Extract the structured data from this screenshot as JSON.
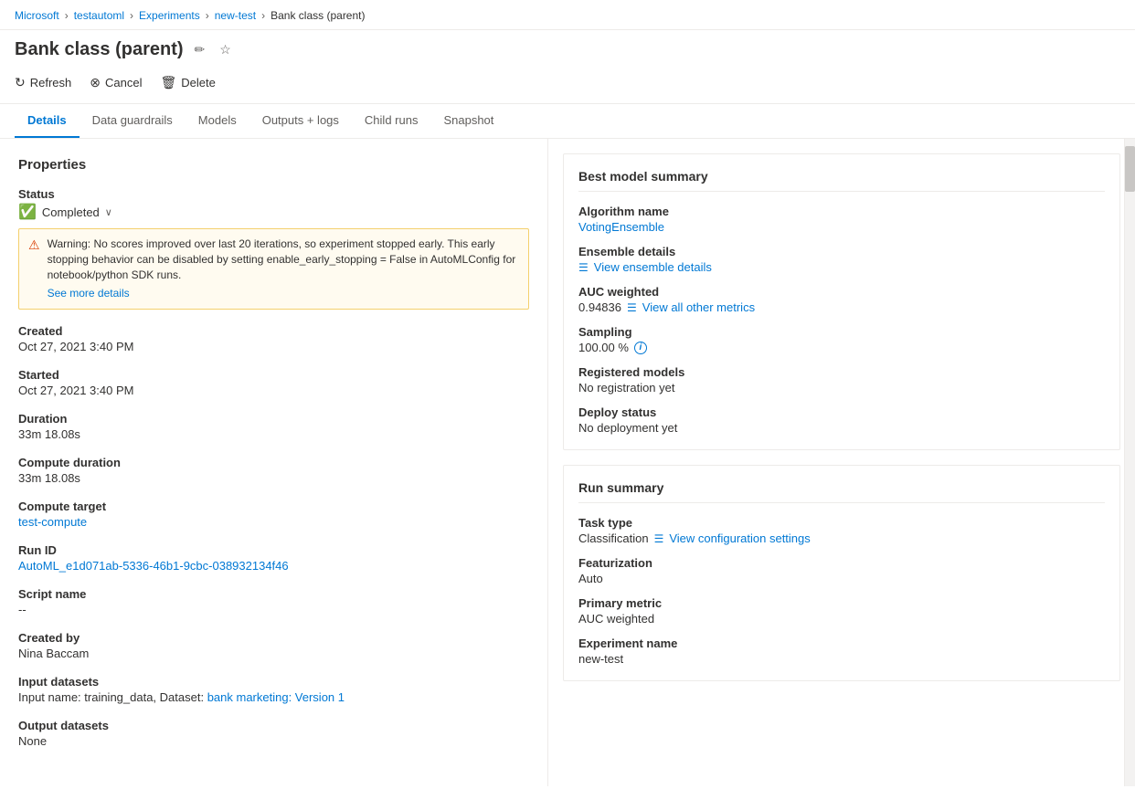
{
  "breadcrumb": {
    "items": [
      {
        "label": "Microsoft",
        "href": "#"
      },
      {
        "label": "testautoml",
        "href": "#"
      },
      {
        "label": "Experiments",
        "href": "#"
      },
      {
        "label": "new-test",
        "href": "#"
      },
      {
        "label": "Bank class (parent)",
        "current": true
      }
    ]
  },
  "header": {
    "title": "Bank class (parent)",
    "edit_label": "✏",
    "star_label": "☆"
  },
  "toolbar": {
    "refresh_label": "Refresh",
    "cancel_label": "Cancel",
    "delete_label": "Delete"
  },
  "tabs": [
    {
      "label": "Details",
      "active": true
    },
    {
      "label": "Data guardrails"
    },
    {
      "label": "Models"
    },
    {
      "label": "Outputs + logs"
    },
    {
      "label": "Child runs"
    },
    {
      "label": "Snapshot"
    }
  ],
  "properties": {
    "section_title": "Properties",
    "status": {
      "label": "Status",
      "value": "Completed",
      "dropdown": "v"
    },
    "warning": {
      "text": "Warning: No scores improved over last 20 iterations, so experiment stopped early. This early stopping behavior can be disabled by setting enable_early_stopping = False in AutoMLConfig for notebook/python SDK runs.",
      "see_more": "See more details"
    },
    "created": {
      "label": "Created",
      "value": "Oct 27, 2021 3:40 PM"
    },
    "started": {
      "label": "Started",
      "value": "Oct 27, 2021 3:40 PM"
    },
    "duration": {
      "label": "Duration",
      "value": "33m 18.08s"
    },
    "compute_duration": {
      "label": "Compute duration",
      "value": "33m 18.08s"
    },
    "compute_target": {
      "label": "Compute target",
      "value": "test-compute"
    },
    "run_id": {
      "label": "Run ID",
      "value": "AutoML_e1d071ab-5336-46b1-9cbc-038932134f46"
    },
    "script_name": {
      "label": "Script name",
      "value": "--"
    },
    "created_by": {
      "label": "Created by",
      "value": "Nina Baccam"
    },
    "input_datasets": {
      "label": "Input datasets",
      "value_prefix": "Input name: training_data, Dataset: ",
      "link_text": "bank marketing: Version 1"
    },
    "output_datasets": {
      "label": "Output datasets",
      "value": "None"
    }
  },
  "best_model_summary": {
    "section_title": "Best model summary",
    "algorithm_name": {
      "label": "Algorithm name",
      "value": "VotingEnsemble"
    },
    "ensemble_details": {
      "label": "Ensemble details",
      "link": "View ensemble details"
    },
    "auc_weighted": {
      "label": "AUC weighted",
      "value": "0.94836",
      "metrics_link": "View all other metrics"
    },
    "sampling": {
      "label": "Sampling",
      "value": "100.00 %"
    },
    "registered_models": {
      "label": "Registered models",
      "value": "No registration yet"
    },
    "deploy_status": {
      "label": "Deploy status",
      "value": "No deployment yet"
    }
  },
  "run_summary": {
    "section_title": "Run summary",
    "task_type": {
      "label": "Task type",
      "value": "Classification",
      "config_link": "View configuration settings"
    },
    "featurization": {
      "label": "Featurization",
      "value": "Auto"
    },
    "primary_metric": {
      "label": "Primary metric",
      "value": "AUC weighted"
    },
    "experiment_name": {
      "label": "Experiment name",
      "value": "new-test"
    }
  }
}
